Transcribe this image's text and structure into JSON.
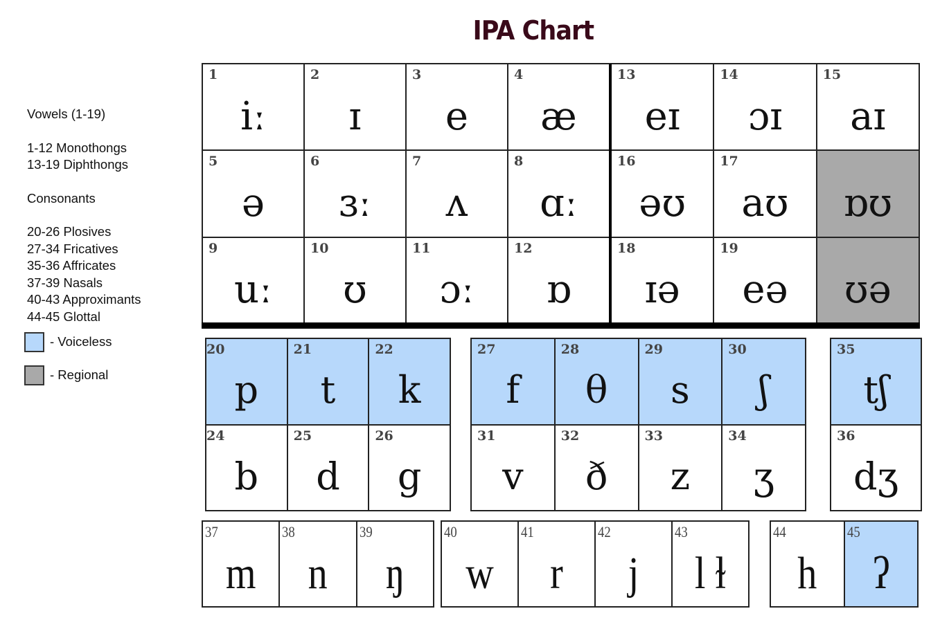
{
  "title": "IPA Chart",
  "legend": {
    "vowels_heading": "Vowels (1-19)",
    "monophthongs": "1-12 Monothongs",
    "diphthongs": "13-19 Diphthongs",
    "consonants_heading": "Consonants",
    "plosives": "20-26 Plosives",
    "fricatives": "27-34 Fricatives",
    "affricates": "35-36 Affricates",
    "nasals": "37-39 Nasals",
    "approximants": "40-43 Approximants",
    "glottal": "44-45 Glottal",
    "voiceless_label": "- Voiceless",
    "regional_label": "- Regional"
  },
  "colors": {
    "voiceless": "#b7d8fb",
    "regional": "#a9a9a9",
    "title": "#3a0a1a"
  },
  "groups": {
    "monophthongs": [
      {
        "num": "1",
        "symbol": "iː",
        "type": "normal"
      },
      {
        "num": "2",
        "symbol": "ɪ",
        "type": "normal"
      },
      {
        "num": "3",
        "symbol": "e",
        "type": "normal"
      },
      {
        "num": "4",
        "symbol": "æ",
        "type": "normal"
      },
      {
        "num": "5",
        "symbol": "ə",
        "type": "normal"
      },
      {
        "num": "6",
        "symbol": "ɜː",
        "type": "normal"
      },
      {
        "num": "7",
        "symbol": "ʌ",
        "type": "normal"
      },
      {
        "num": "8",
        "symbol": "ɑː",
        "type": "normal"
      },
      {
        "num": "9",
        "symbol": "uː",
        "type": "normal"
      },
      {
        "num": "10",
        "symbol": "ʊ",
        "type": "normal"
      },
      {
        "num": "11",
        "symbol": "ɔː",
        "type": "normal"
      },
      {
        "num": "12",
        "symbol": "ɒ",
        "type": "normal"
      }
    ],
    "diphthongs": [
      {
        "num": "13",
        "symbol": "eɪ",
        "type": "normal"
      },
      {
        "num": "14",
        "symbol": "ɔɪ",
        "type": "normal"
      },
      {
        "num": "15",
        "symbol": "aɪ",
        "type": "normal"
      },
      {
        "num": "16",
        "symbol": "əʊ",
        "type": "normal"
      },
      {
        "num": "17",
        "symbol": "aʊ",
        "type": "normal"
      },
      {
        "num": "",
        "symbol": "ɒʊ",
        "type": "regional"
      },
      {
        "num": "18",
        "symbol": "ɪə",
        "type": "normal"
      },
      {
        "num": "19",
        "symbol": "eə",
        "type": "normal"
      },
      {
        "num": "",
        "symbol": "ʊə",
        "type": "regional"
      }
    ],
    "plosives": [
      {
        "num": "20",
        "symbol": "p",
        "type": "voiceless"
      },
      {
        "num": "21",
        "symbol": "t",
        "type": "voiceless"
      },
      {
        "num": "22",
        "symbol": "k",
        "type": "voiceless"
      },
      {
        "num": "24",
        "symbol": "b",
        "type": "normal"
      },
      {
        "num": "25",
        "symbol": "d",
        "type": "normal"
      },
      {
        "num": "26",
        "symbol": "g",
        "type": "normal"
      }
    ],
    "fricatives": [
      {
        "num": "27",
        "symbol": "f",
        "type": "voiceless"
      },
      {
        "num": "28",
        "symbol": "θ",
        "type": "voiceless"
      },
      {
        "num": "29",
        "symbol": "s",
        "type": "voiceless"
      },
      {
        "num": "30",
        "symbol": "ʃ",
        "type": "voiceless"
      },
      {
        "num": "31",
        "symbol": "v",
        "type": "normal"
      },
      {
        "num": "32",
        "symbol": "ð",
        "type": "normal"
      },
      {
        "num": "33",
        "symbol": "z",
        "type": "normal"
      },
      {
        "num": "34",
        "symbol": "ʒ",
        "type": "normal"
      }
    ],
    "affricates": [
      {
        "num": "35",
        "symbol": "tʃ",
        "type": "voiceless"
      },
      {
        "num": "36",
        "symbol": "dʒ",
        "type": "normal"
      }
    ],
    "nasals": [
      {
        "num": "37",
        "symbol": "m",
        "type": "normal"
      },
      {
        "num": "38",
        "symbol": "n",
        "type": "normal"
      },
      {
        "num": "39",
        "symbol": "ŋ",
        "type": "normal"
      }
    ],
    "approximants": [
      {
        "num": "40",
        "symbol": "w",
        "type": "normal"
      },
      {
        "num": "41",
        "symbol": "r",
        "type": "normal"
      },
      {
        "num": "42",
        "symbol": "j",
        "type": "normal"
      },
      {
        "num": "43",
        "symbol": "l ɫ",
        "type": "normal"
      }
    ],
    "glottal": [
      {
        "num": "44",
        "symbol": "h",
        "type": "normal"
      },
      {
        "num": "45",
        "symbol": "ʔ",
        "type": "voiceless"
      }
    ]
  }
}
